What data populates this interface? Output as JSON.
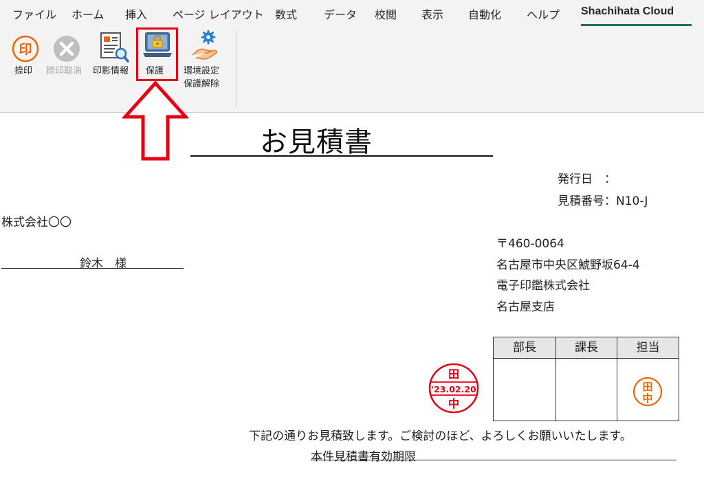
{
  "ribbon": {
    "tabs": [
      {
        "label": "ファイル"
      },
      {
        "label": "ホーム"
      },
      {
        "label": "挿入"
      },
      {
        "label": "ページ レイアウト"
      },
      {
        "label": "数式"
      },
      {
        "label": "データ"
      },
      {
        "label": "校閲"
      },
      {
        "label": "表示"
      },
      {
        "label": "自動化"
      },
      {
        "label": "ヘルプ"
      },
      {
        "label": "Shachihata Cloud",
        "active": true
      }
    ],
    "tools": {
      "stamp": {
        "label": "捺印",
        "icon_glyph": "印"
      },
      "cancel": {
        "label": "捺印取消",
        "disabled": true
      },
      "stamp_info": {
        "label": "印影情報"
      },
      "protect": {
        "label": "保護"
      },
      "settings": {
        "label_line1": "環境設定",
        "label_line2": "保護解除"
      }
    },
    "accent_color": "#217346",
    "highlight_color": "#e60012"
  },
  "document": {
    "title": "お見積書",
    "issue_date_label": "発行日　：",
    "estimate_no_label": "見積番号：N10-J",
    "customer_company": "株式会社〇〇",
    "customer_name": "鈴木　様",
    "sender": {
      "postal": "〒460-0064",
      "address": "名古屋市中央区鯱野坂64-4",
      "company": "電子印鑑株式会社",
      "branch": "名古屋支店"
    },
    "approval": {
      "headers": [
        "部長",
        "課長",
        "担当"
      ],
      "tantou_stamp": {
        "top": "田",
        "bottom": "中"
      }
    },
    "date_stamp": {
      "top": "田",
      "date": "'23.02.20",
      "bottom": "中"
    },
    "message": "下記の通りお見積致します。ご検討のほど、よろしくお願いいたします。",
    "validity_label": "本件見積書有効期限",
    "stamp_colors": {
      "date": "#e60012",
      "personal": "#e8650a"
    }
  }
}
